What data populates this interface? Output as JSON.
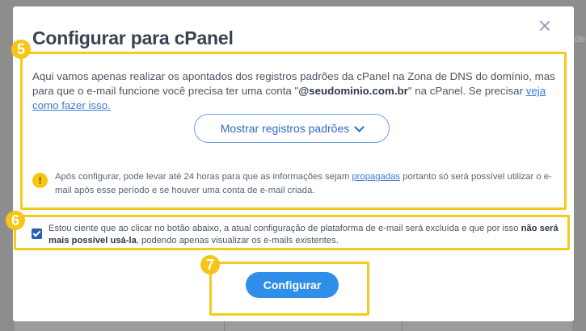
{
  "background": {
    "right_text": "de"
  },
  "modal": {
    "title": "Configurar para cPanel",
    "intro": {
      "text1": "Aqui vamos apenas realizar os apontados dos registros padrões da cPanel na Zona de DNS do domínio, mas para que o e-mail funcione você precisa ter uma conta \"",
      "domain": "@seudominio.com.br",
      "text2": "\" na cPanel. Se precisar ",
      "link": "veja como fazer isso."
    },
    "show_records_button": "Mostrar registros padrões",
    "warning": {
      "text1": "Após configurar, pode levar até 24 horas para que as informações sejam ",
      "link": "propagadas",
      "text2": " portanto só será possível utilizar o e-mail após esse período e se houver uma conta de e-mail criada."
    },
    "agreement": {
      "checked": true,
      "text1": "Estou ciente que ao clicar no botão abaixo, a atual configuração de plataforma de e-mail será excluída e que por isso ",
      "bold": "não será mais possível usá-la",
      "text2": ", podendo apenas visualizar os e-mails existentes."
    },
    "submit_button": "Configurar"
  },
  "annotations": {
    "badge5": "5",
    "badge6": "6",
    "badge7": "7"
  },
  "colors": {
    "highlight": "#f2cb1d",
    "primary": "#2f8fe8",
    "link": "#3a7bd5"
  }
}
